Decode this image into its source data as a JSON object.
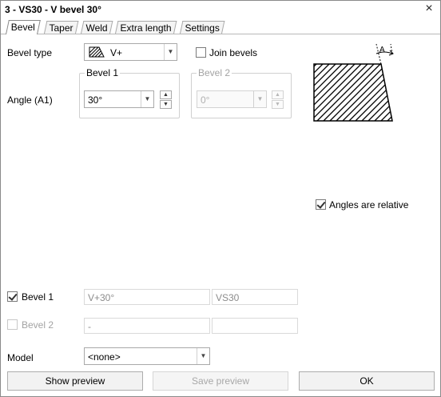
{
  "window": {
    "title": "3 - VS30 - V bevel 30°",
    "close_glyph": "×"
  },
  "tabs": [
    {
      "label": "Bevel",
      "active": true
    },
    {
      "label": "Taper"
    },
    {
      "label": "Weld"
    },
    {
      "label": "Extra length"
    },
    {
      "label": "Settings"
    }
  ],
  "bevel_type": {
    "label": "Bevel type",
    "value": "V+"
  },
  "join_bevels": {
    "label": "Join bevels",
    "checked": false
  },
  "angle": {
    "label": "Angle (A1)",
    "bevel1_title": "Bevel 1",
    "bevel1_value": "30°",
    "bevel2_title": "Bevel 2",
    "bevel2_value": "0°"
  },
  "diagram": {
    "angle_label": "A"
  },
  "angles_relative": {
    "label": "Angles are relative",
    "checked": true
  },
  "bevels": [
    {
      "label": "Bevel 1",
      "checked": true,
      "enabled": true,
      "value1": "V+30°",
      "value2": "VS30"
    },
    {
      "label": "Bevel 2",
      "checked": false,
      "enabled": false,
      "value1": "-",
      "value2": ""
    }
  ],
  "model": {
    "label": "Model",
    "value": "<none>"
  },
  "buttons": {
    "show_preview": "Show preview",
    "save_preview": "Save preview",
    "ok": "OK"
  }
}
